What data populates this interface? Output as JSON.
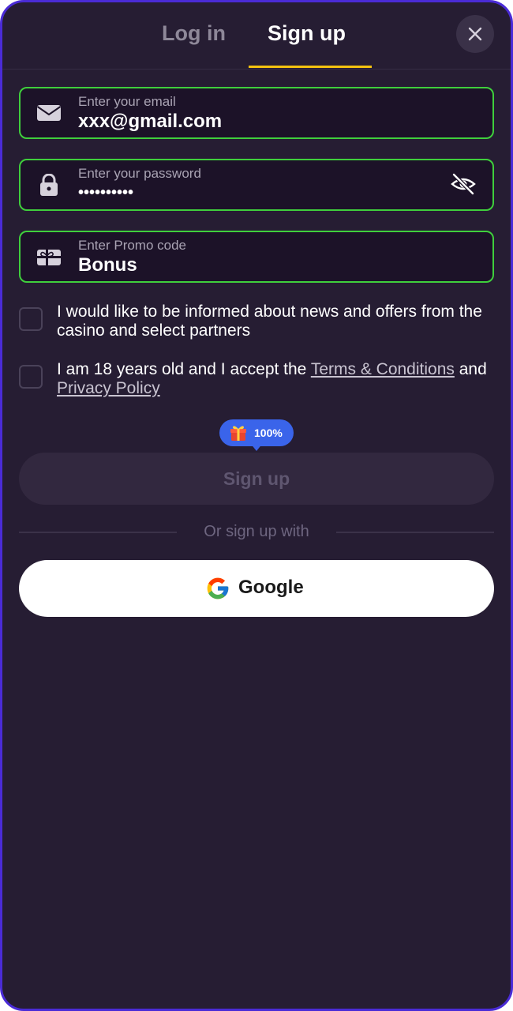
{
  "tabs": {
    "login": "Log in",
    "signup": "Sign up"
  },
  "close_icon": "close-icon",
  "fields": {
    "email": {
      "label": "Enter your email",
      "value": "xxx@gmail.com",
      "icon": "envelope-icon"
    },
    "password": {
      "label": "Enter your password",
      "value": "••••••••••",
      "icon": "lock-icon",
      "toggle_icon": "eye-off-icon"
    },
    "promo": {
      "label": "Enter Promo code",
      "value": "Bonus",
      "icon": "gift-card-icon"
    }
  },
  "checkboxes": {
    "news": {
      "text": "I would like to be informed about news and offers from the casino and select partners"
    },
    "terms": {
      "prefix": "I am 18 years old and I accept the ",
      "terms_link": "Terms & Conditions",
      "middle": " and ",
      "privacy_link": "Privacy Policy"
    }
  },
  "bonus_badge": {
    "text": "100%",
    "icon": "gift-icon"
  },
  "signup_button": "Sign up",
  "divider_text": "Or sign up with",
  "google_button": {
    "label": "Google",
    "icon": "google-icon"
  },
  "colors": {
    "background": "#261d33",
    "frame_border": "#4a2bd6",
    "field_border": "#3fcf3c",
    "tab_underline": "#f3c20f",
    "badge": "#3a64ea"
  }
}
